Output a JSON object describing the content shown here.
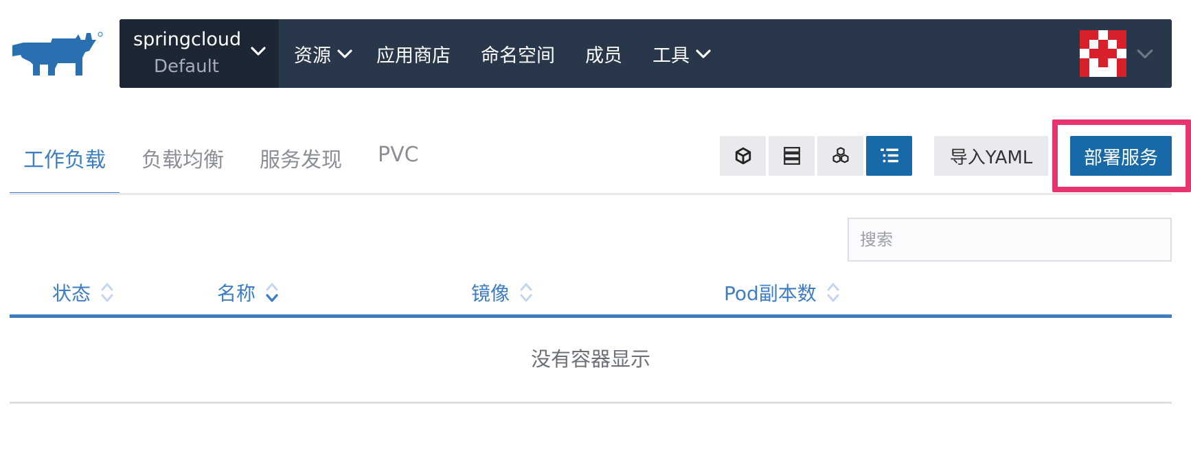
{
  "colors": {
    "nav_bg": "#283749",
    "cluster_bg": "#1d2633",
    "accent": "#1769a8",
    "link": "#3d7dc3",
    "highlight": "#e8356f",
    "logo": "#2a6fb0"
  },
  "brand": {
    "logo_icon": "rancher-bull-logo-icon"
  },
  "nav": {
    "cluster_name": "springcloud",
    "project_name": "Default",
    "items": [
      {
        "label": "资源",
        "has_dropdown": true
      },
      {
        "label": "应用商店",
        "has_dropdown": false
      },
      {
        "label": "命名空间",
        "has_dropdown": false
      },
      {
        "label": "成员",
        "has_dropdown": false
      },
      {
        "label": "工具",
        "has_dropdown": true
      }
    ],
    "user_avatar": "identicon-avatar"
  },
  "tabs": [
    {
      "label": "工作负载",
      "active": true
    },
    {
      "label": "负载均衡",
      "active": false
    },
    {
      "label": "服务发现",
      "active": false
    },
    {
      "label": "PVC",
      "active": false
    }
  ],
  "view_toggles": [
    {
      "icon": "cube-icon",
      "active": false
    },
    {
      "icon": "server-stack-icon",
      "active": false
    },
    {
      "icon": "cubes-group-icon",
      "active": false
    },
    {
      "icon": "list-icon",
      "active": true
    }
  ],
  "actions": {
    "import_label": "导入YAML",
    "deploy_label": "部署服务"
  },
  "search": {
    "placeholder": "搜索",
    "value": ""
  },
  "table": {
    "columns": [
      {
        "label": "状态",
        "sort": "none"
      },
      {
        "label": "名称",
        "sort": "descending"
      },
      {
        "label": "镜像",
        "sort": "none"
      },
      {
        "label": "Pod副本数",
        "sort": "none"
      }
    ],
    "empty_message": "没有容器显示"
  }
}
